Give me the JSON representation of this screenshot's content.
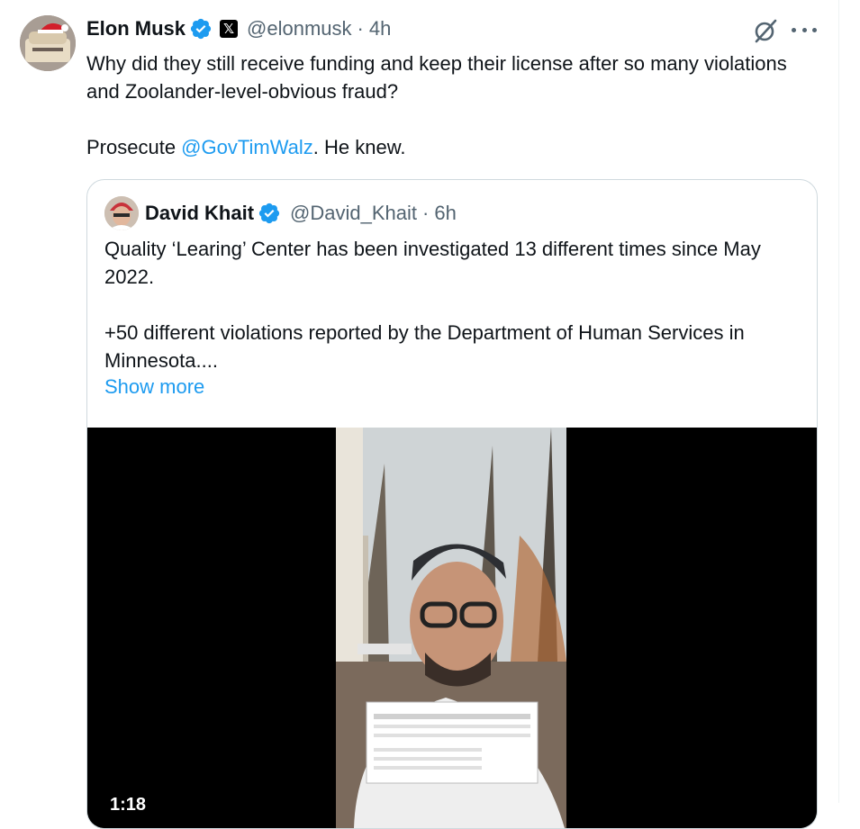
{
  "tweet": {
    "author_name": "Elon Musk",
    "handle": "@elonmusk",
    "separator": "·",
    "time": "4h",
    "text_line1": "Why did they still receive funding and keep their license after so many violations and Zoolander-level-obvious fraud?",
    "text_prefix": "Prosecute ",
    "mention": "@GovTimWalz",
    "text_suffix": ". He knew.",
    "x_badge": "𝕏",
    "icons": [
      "verified-badge-icon",
      "x-affiliate-icon",
      "grok-icon",
      "more-icon"
    ]
  },
  "quote": {
    "author_name": "David Khait",
    "handle": "@David_Khait",
    "separator": "·",
    "time": "6h",
    "text": "Quality ‘Learing’ Center has been investigated 13 different times since May 2022.\n\n+50 different violations reported by the Department of Human Services in Minnesota....",
    "show_more": "Show more",
    "video_time": "1:18"
  },
  "colors": {
    "text": "#0f1419",
    "secondary": "#536471",
    "link": "#1d9bf0",
    "border": "#cfd9de"
  }
}
